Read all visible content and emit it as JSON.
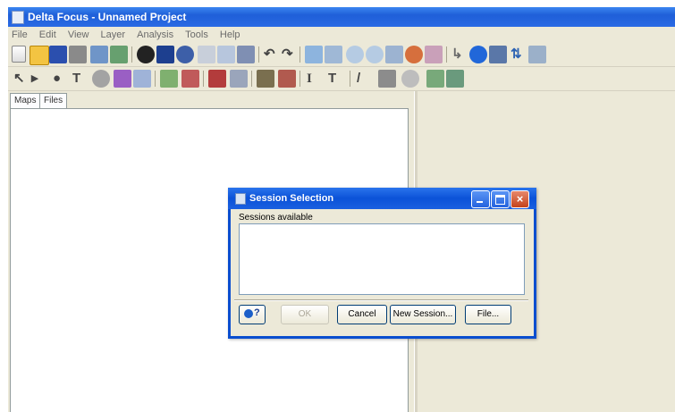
{
  "window": {
    "title": "Delta Focus - Unnamed Project"
  },
  "menubar": {
    "items": [
      "File",
      "Edit",
      "View",
      "Layer",
      "Analysis",
      "Tools",
      "Help"
    ]
  },
  "toolbar1": {
    "icons": [
      "new-icon",
      "open-icon",
      "save-icon",
      "print-icon",
      "preview-icon",
      "image-icon",
      "layer-icon",
      "table-icon",
      "database-icon",
      "cut-icon",
      "copy-icon",
      "paste-icon",
      "undo-icon",
      "redo-icon",
      "select-icon",
      "clear-icon",
      "zoom-in-icon",
      "zoom-out-icon",
      "zoom-rect-icon",
      "refresh-icon",
      "export-icon",
      "pointer-icon",
      "info-icon",
      "grid-icon",
      "sort-icon",
      "more-icon"
    ]
  },
  "toolbar2": {
    "icons": [
      "arrow-icon",
      "play-icon",
      "point-icon",
      "text-icon",
      "shape-icon",
      "color-icon",
      "fill-icon",
      "line-style-icon",
      "symbol-icon",
      "line-color-icon",
      "line-width-icon",
      "fill-color-icon",
      "text-color-icon",
      "font-icon",
      "text-size-icon",
      "line-icon",
      "marker-icon",
      "circle-icon",
      "layer-view-icon",
      "layer-edit-icon"
    ]
  },
  "tabs": [
    {
      "label": "Maps"
    },
    {
      "label": "Files"
    }
  ],
  "dialog": {
    "title": "Session Selection",
    "sessions_label": "Sessions available",
    "help_label": "?",
    "ok_label": "OK",
    "cancel_label": "Cancel",
    "new_session_label": "New Session...",
    "file_label": "File..."
  },
  "colors": {
    "titlebar": "#2a6ae4",
    "dialog_titlebar": "#0b52d8",
    "chrome": "#ece9d8",
    "close_button": "#c4431c"
  }
}
